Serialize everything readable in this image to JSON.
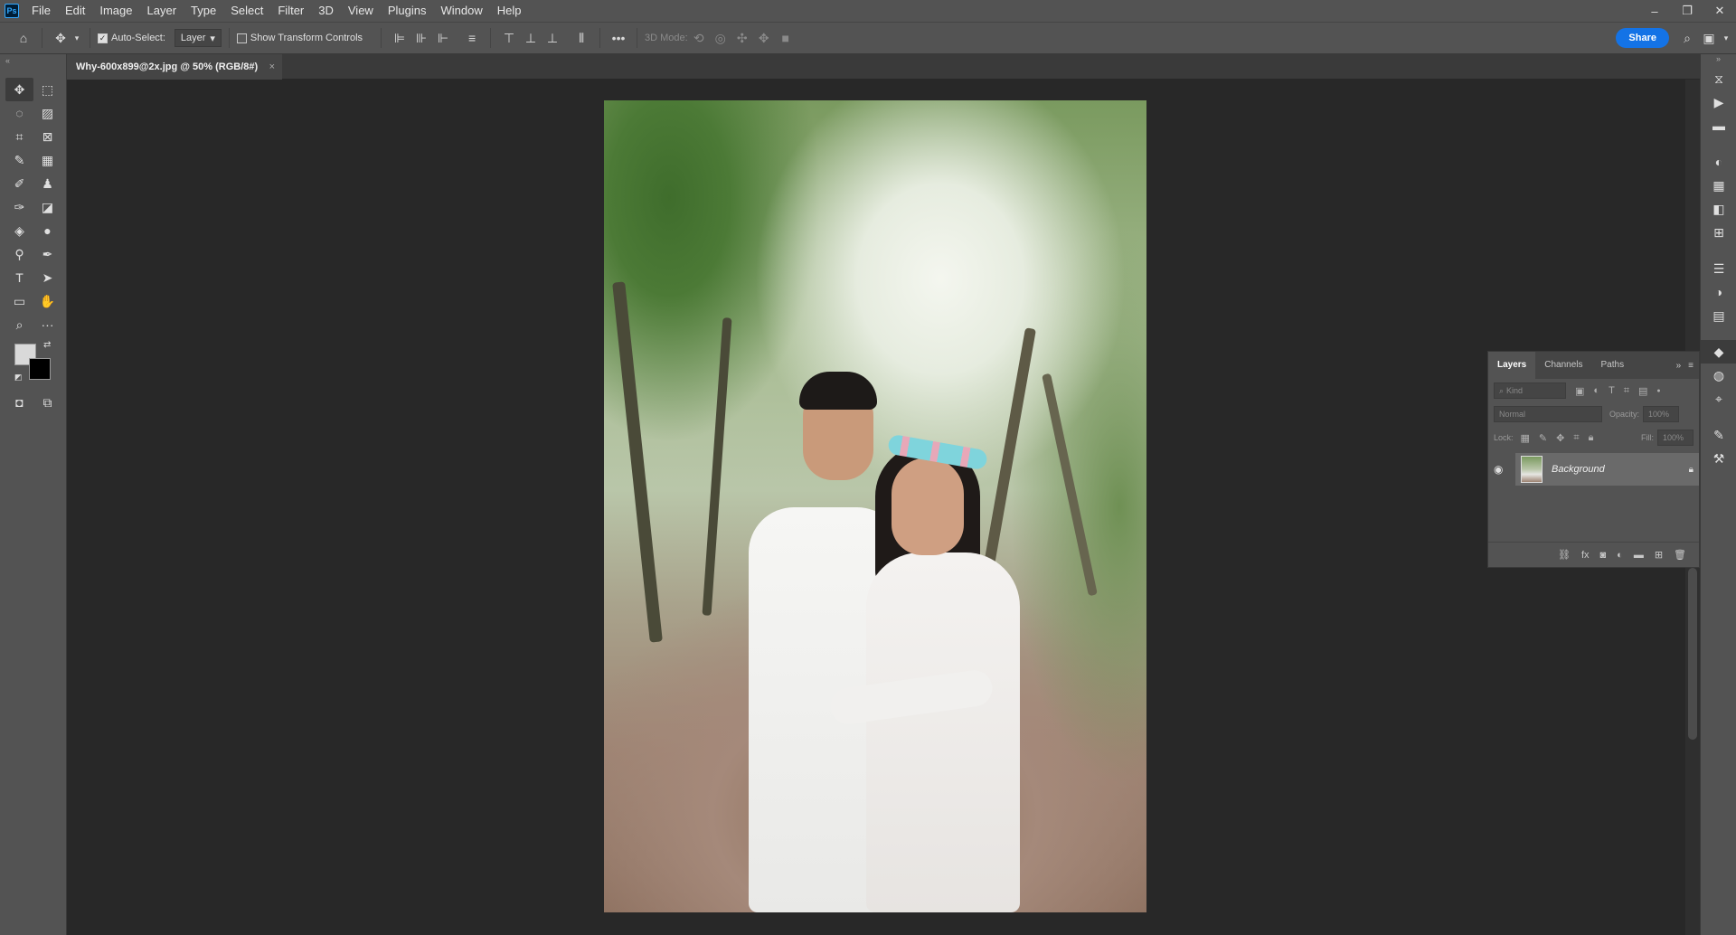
{
  "menubar": {
    "app_badge": "Ps",
    "items": [
      "File",
      "Edit",
      "Image",
      "Layer",
      "Type",
      "Select",
      "Filter",
      "3D",
      "View",
      "Plugins",
      "Window",
      "Help"
    ],
    "window_controls": [
      "–",
      "❐",
      "✕"
    ]
  },
  "options": {
    "auto_select_label": "Auto-Select:",
    "auto_select_checked": true,
    "auto_select_target": "Layer",
    "show_transform_controls_label": "Show Transform Controls",
    "show_transform_controls_checked": false,
    "mode_3d_label": "3D Mode:",
    "share_label": "Share"
  },
  "document": {
    "tab_title": "Why-600x899@2x.jpg @ 50% (RGB/8#)",
    "close_glyph": "×"
  },
  "layers_panel": {
    "tabs": [
      "Layers",
      "Channels",
      "Paths"
    ],
    "active_tab": "Layers",
    "kind_placeholder": "Kind",
    "blend_mode": "Normal",
    "opacity_label": "Opacity:",
    "opacity_value": "100%",
    "lock_label": "Lock:",
    "fill_label": "Fill:",
    "fill_value": "100%",
    "layers": [
      {
        "name": "Background",
        "visible": true,
        "locked": true
      }
    ]
  },
  "colors": {
    "foreground": "#d9d9d9",
    "background": "#000000",
    "accent": "#1473e6"
  }
}
